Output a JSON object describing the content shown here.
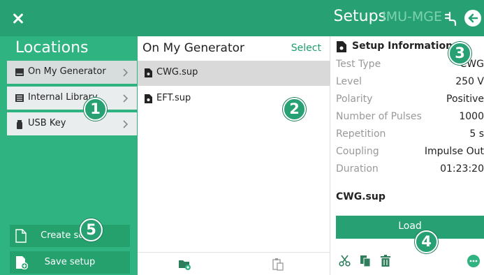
{
  "header": {
    "title": "Setups",
    "device": "IMU-MGE"
  },
  "locations": {
    "title": "Locations",
    "items": [
      {
        "label": "On My Generator"
      },
      {
        "label": "Internal Library"
      },
      {
        "label": "USB Key"
      }
    ],
    "create_label": "Create setup",
    "save_label": "Save setup"
  },
  "files": {
    "title": "On My Generator",
    "select_label": "Select",
    "items": [
      {
        "name": "CWG.sup",
        "selected": true
      },
      {
        "name": "EFT.sup",
        "selected": false
      }
    ]
  },
  "info": {
    "title": "Setup Information",
    "rows": [
      {
        "key": "Test Type",
        "value": "CWG"
      },
      {
        "key": "Level",
        "value": "250 V"
      },
      {
        "key": "Polarity",
        "value": "Positive"
      },
      {
        "key": "Number of Pulses",
        "value": "1000"
      },
      {
        "key": "Repetition",
        "value": "5 s"
      },
      {
        "key": "Coupling",
        "value": "Impulse Out"
      },
      {
        "key": "Duration",
        "value": "01:23:20"
      }
    ],
    "file_name": "CWG.sup",
    "load_label": "Load"
  },
  "callouts": [
    "1",
    "2",
    "3",
    "4",
    "5"
  ],
  "icons": {
    "close": "close-icon",
    "plug": "plug-icon",
    "back": "back-arrow-icon",
    "drive": "drive-icon",
    "library": "library-icon",
    "usb": "usb-icon",
    "chevron": "chevron-right-icon",
    "file": "file-icon",
    "new_document": "new-document-icon",
    "save_document": "save-document-icon",
    "new_folder": "new-folder-icon",
    "paste": "paste-icon",
    "cut": "scissors-icon",
    "copy": "copy-icon",
    "delete": "trash-icon",
    "more": "more-icon"
  },
  "colors": {
    "primary": "#27a173",
    "panel": "#2fb380",
    "accent_text": "#1f9c6c",
    "muted_text": "#999999",
    "selected_row": "#d9d9d9"
  }
}
